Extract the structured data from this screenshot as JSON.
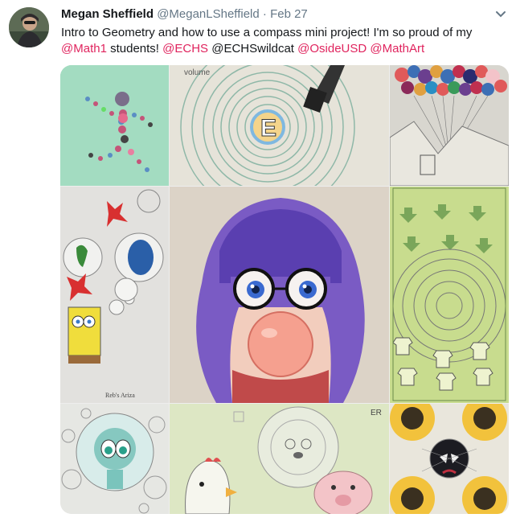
{
  "tweet": {
    "author_name": "Megan Sheffield",
    "author_handle": "@MeganLSheffield",
    "separator": "·",
    "date": "Feb 27",
    "text_parts": [
      {
        "text": "Intro to Geometry and how to use a compass mini project! I'm so proud of my ",
        "type": "plain"
      },
      {
        "text": "@Math1",
        "type": "mention"
      },
      {
        "text": " students! ",
        "type": "plain"
      },
      {
        "text": "@ECHS",
        "type": "mention"
      },
      {
        "text": " @ECHSwildcat ",
        "type": "plain"
      },
      {
        "text": " @OsideUSD",
        "type": "mention"
      },
      {
        "text": " ",
        "type": "plain"
      },
      {
        "text": "@MathArt",
        "type": "mention"
      }
    ],
    "mention_color": "#e0245e"
  },
  "media": {
    "drawing_labels": {
      "volume": "volume",
      "e_letter": "E",
      "signature": "Reb's Ariza",
      "tag": "ER"
    }
  }
}
